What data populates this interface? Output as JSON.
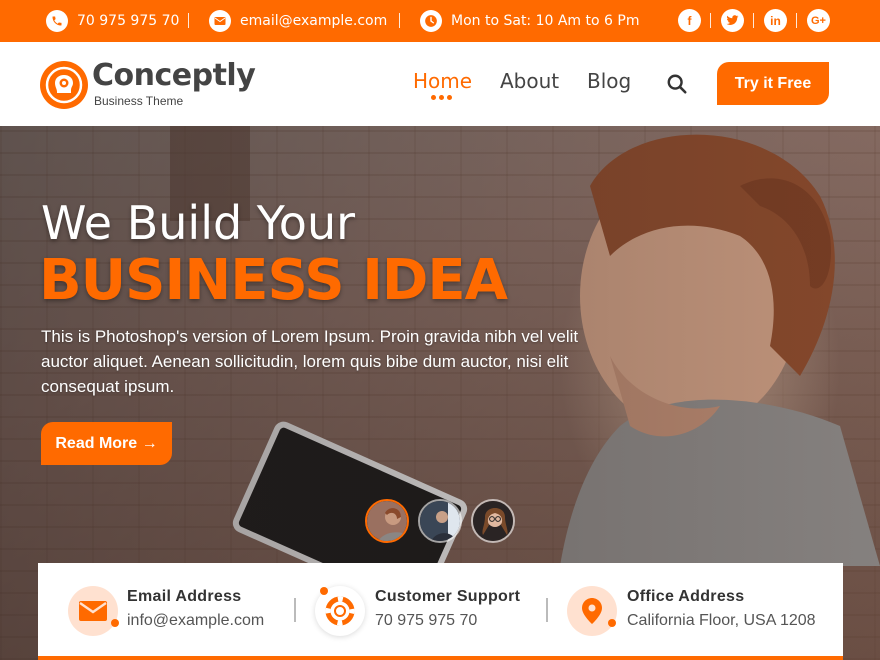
{
  "topbar": {
    "phone": "70 975 975 70",
    "email": "email@example.com",
    "hours": "Mon to Sat: 10 Am to 6 Pm",
    "social": [
      {
        "icon": "facebook-icon",
        "glyph": "f"
      },
      {
        "icon": "twitter-icon",
        "glyph": "t"
      },
      {
        "icon": "linkedin-icon",
        "glyph": "in"
      },
      {
        "icon": "google-plus-icon",
        "glyph": "G+"
      }
    ]
  },
  "brand": {
    "name": "Conceptly",
    "tagline": "Business Theme"
  },
  "nav": {
    "items": [
      "Home",
      "About",
      "Blog"
    ],
    "active": "Home",
    "cta": "Try it Free"
  },
  "hero": {
    "heading": "We Build Your",
    "highlight": "BUSINESS IDEA",
    "description": "This is Photoshop's version  of Lorem Ipsum. Proin gravida nibh vel velit auctor aliquet. Aenean sollicitudin, lorem quis bibe dum auctor, nisi elit consequat ipsum.",
    "button": "Read More →",
    "slides_count": 3,
    "active_slide": 1
  },
  "info": [
    {
      "title": "Email Address",
      "value": "info@example.com",
      "icon": "envelope-icon"
    },
    {
      "title": "Customer Support",
      "value": "70 975 975 70",
      "icon": "lifebuoy-icon"
    },
    {
      "title": "Office Address",
      "value": "California Floor, USA 1208",
      "icon": "map-pin-icon"
    }
  ],
  "colors": {
    "accent": "#ff6a00",
    "text": "#444444",
    "white": "#ffffff"
  }
}
